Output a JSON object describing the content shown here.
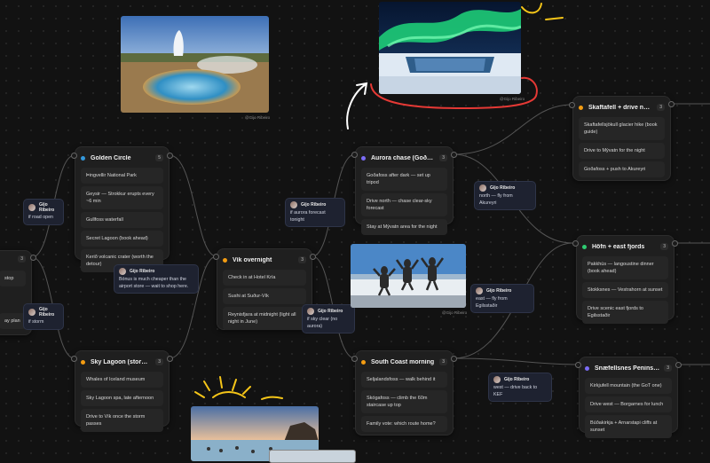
{
  "colors": {
    "orange": "#f39c12",
    "blue": "#3498db",
    "purple": "#7b6cf6",
    "green": "#2ecc71",
    "ink_yellow": "#f5c518",
    "ink_red": "#e53935",
    "ink_white": "#ffffff"
  },
  "cards": {
    "golden_circle": {
      "title": "Golden Circle",
      "count": "5",
      "items": [
        "Þingvellir National Park",
        "Geysir — Strokkur erupts every ~6 min",
        "Gullfoss waterfall",
        "Secret Lagoon (book ahead)",
        "Kerið volcanic crater (worth the detour)"
      ]
    },
    "sky_lagoon": {
      "title": "Sky Lagoon (storm day)",
      "count": "3",
      "items": [
        "Whales of Iceland museum",
        "Sky Lagoon spa, late afternoon",
        "Drive to Vík once the storm passes"
      ]
    },
    "vik": {
      "title": "Vík overnight",
      "count": "3",
      "items": [
        "Check in at Hotel Kría",
        "Sushi at Suður-Vík",
        "Reynisfjara at midnight (light all night in June)"
      ]
    },
    "aurora": {
      "title": "Aurora chase (Goðafoss area)",
      "count": "3",
      "items": [
        "Goðafoss after dark — set up tripod",
        "Drive north — chase clear-sky forecast",
        "Stay at Mývatn area for the night"
      ]
    },
    "south_coast": {
      "title": "South Coast morning",
      "count": "3",
      "items": [
        "Seljalandsfoss — walk behind it",
        "Skógafoss — climb the 60m staircase up top",
        "Family vote: which route home?"
      ]
    },
    "skaftafell": {
      "title": "Skaftafell + drive north",
      "count": "3",
      "items": [
        "Skaftafellsjökull glacier hike (book guide)",
        "Drive to Mývatn for the night",
        "Goðafoss + push to Akureyri"
      ]
    },
    "hofn": {
      "title": "Höfn + east fjords",
      "count": "3",
      "items": [
        "Pakkhús — langoustine dinner (book ahead)",
        "Stokksnes — Vestrahorn at sunset",
        "Drive scenic east fjords to Egilsstaðir"
      ]
    },
    "snaefellsnes": {
      "title": "Snæfellsnes Peninsula",
      "count": "3",
      "items": [
        "Kirkjufell mountain (the GoT one)",
        "Drive west — Borgarnes for lunch",
        "Búðakirkja + Arnarstapi cliffs at sunset"
      ]
    },
    "left_partial": {
      "count": "3",
      "items": [
        "stop",
        "ay plan"
      ]
    }
  },
  "comments": [
    {
      "author": "Gijo Ribeiro",
      "text": "if road open"
    },
    {
      "author": "Gijo Ribeiro",
      "text": "if storm"
    },
    {
      "author": "Gijo Ribeiro",
      "text": "Bónus is much cheaper than the airport store — wait to shop here."
    },
    {
      "author": "Gijo Ribeiro",
      "text": "if aurora forecast tonight"
    },
    {
      "author": "Gijo Ribeiro",
      "text": "if sky clear (no aurora)"
    },
    {
      "author": "Gijo Ribeiro",
      "text": "north — fly from Akureyri"
    },
    {
      "author": "Gijo Ribeiro",
      "text": "east — fly from Egilsstaðir"
    },
    {
      "author": "Gijo Ribeiro",
      "text": "west — drive back to KEF"
    }
  ],
  "photos": {
    "credit": "@Gijo Ribeiro",
    "geysir": "geysir-hot-spring",
    "aurora": "aurora-over-waterfall",
    "group": "group-jumping-on-beach",
    "lagoon": "lagoon-bathers"
  }
}
